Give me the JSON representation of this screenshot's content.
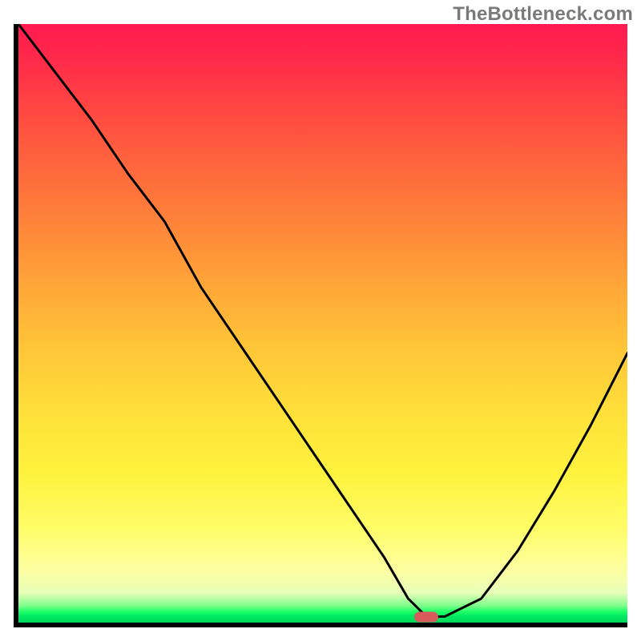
{
  "watermark": "TheBottleneck.com",
  "chart_data": {
    "type": "line",
    "title": "",
    "xlabel": "",
    "ylabel": "",
    "xlim": [
      0,
      100
    ],
    "ylim": [
      0,
      100
    ],
    "grid": false,
    "series": [
      {
        "name": "curve",
        "x": [
          0,
          6,
          12,
          18,
          24,
          30,
          36,
          42,
          48,
          54,
          60,
          64,
          67,
          70,
          76,
          82,
          88,
          94,
          100
        ],
        "y": [
          100,
          92,
          84,
          75,
          67,
          56,
          47,
          38,
          29,
          20,
          11,
          4,
          1,
          1,
          4,
          12,
          22,
          33,
          45
        ]
      }
    ],
    "marker": {
      "x": 67,
      "y": 1
    },
    "gradient_stops": [
      {
        "pos": 0,
        "color": "#ff1a4f"
      },
      {
        "pos": 50,
        "color": "#ffc838"
      },
      {
        "pos": 85,
        "color": "#fffc66"
      },
      {
        "pos": 98,
        "color": "#1cff66"
      },
      {
        "pos": 100,
        "color": "#00d65a"
      }
    ]
  }
}
